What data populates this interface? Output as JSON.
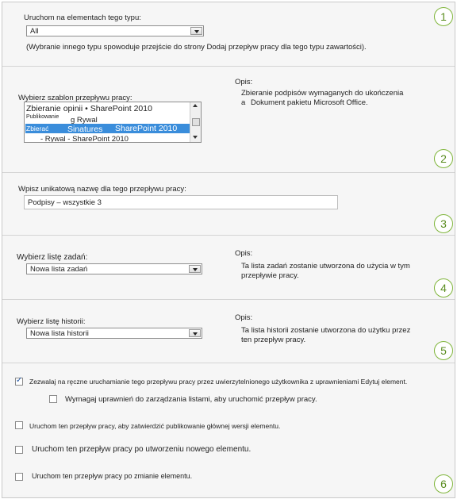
{
  "sections": {
    "s1": {
      "label": "Uruchom na elementach tego typu:",
      "select_value": "All",
      "note": "(Wybranie innego typu spowoduje przejście do strony Dodaj przepływ pracy dla tego typu zawartości).",
      "number": "1"
    },
    "s2": {
      "label": "Wybierz szablon przepływu pracy:",
      "items": [
        "Zbieranie opinii • SharePoint 2010",
        "Publikowanie",
        "g  Rywal",
        "Zbierać",
        "Sinatures",
        "SharePoint 2010",
        "- Rywal - SharePoint 2010"
      ],
      "desc_title": "Opis:",
      "desc_line1": "Zbieranie podpisów wymaganych do ukończenia",
      "desc_bullet": "a",
      "desc_line2": "Dokument pakietu Microsoft Office.",
      "number": "2"
    },
    "s3": {
      "label": "Wpisz unikatową nazwę dla tego przepływu pracy:",
      "input_value": "Podpisy – wszystkie 3",
      "number": "3"
    },
    "s4": {
      "label": "Wybierz listę zadań:",
      "select_value": "Nowa lista zadań",
      "desc_title": "Opis:",
      "desc_line1": "Ta lista zadań zostanie utworzona do użycia w tym",
      "desc_line2": "przepływie pracy.",
      "number": "4"
    },
    "s5": {
      "label": "Wybierz listę historii:",
      "select_value": "Nowa lista historii",
      "desc_title": "Opis:",
      "desc_line1": "Ta lista historii zostanie utworzona do użytku przez",
      "desc_line2": "ten przepływ pracy.",
      "number": "5"
    },
    "s6": {
      "opt1": "Zezwalaj na ręczne uruchamianie tego przepływu pracy przez uwierzytelnionego użytkownika z uprawnieniami Edytuj element.",
      "opt1_checked": true,
      "opt1_sub": "Wymagaj uprawnień do zarządzania listami, aby uruchomić przepływ pracy.",
      "opt2": "Uruchom ten przepływ pracy, aby zatwierdzić publikowanie głównej wersji elementu.",
      "opt3": "Uruchom ten przepływ pracy po utworzeniu nowego elementu.",
      "opt4": "Uruchom ten przepływ pracy po zmianie elementu.",
      "number": "6"
    }
  }
}
